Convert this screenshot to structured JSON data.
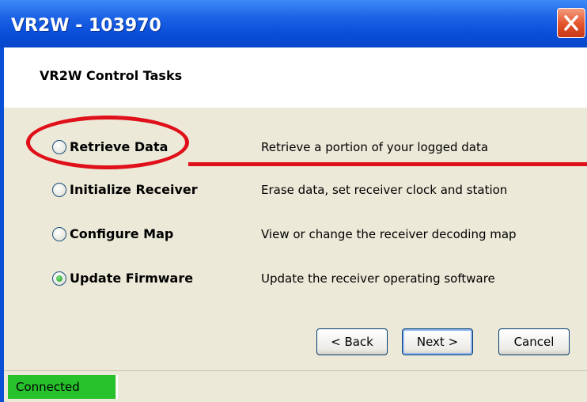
{
  "window": {
    "title": "VR2W - 103970"
  },
  "header": {
    "heading": "VR2W Control Tasks"
  },
  "tasks": [
    {
      "label": "Retrieve Data",
      "description": "Retrieve a portion of your logged data",
      "selected": false
    },
    {
      "label": "Initialize Receiver",
      "description": "Erase data, set receiver clock and station",
      "selected": false
    },
    {
      "label": "Configure Map",
      "description": "View or change the receiver decoding map",
      "selected": false
    },
    {
      "label": "Update Firmware",
      "description": "Update the receiver operating software",
      "selected": true
    }
  ],
  "buttons": {
    "back": "< Back",
    "next": "Next >",
    "cancel": "Cancel"
  },
  "status": {
    "connection": "Connected"
  },
  "colors": {
    "titlebar": "#0a4fd8",
    "annotation": "#e0101a",
    "connected": "#27c12b",
    "panel": "#ece9d8"
  },
  "icons": {
    "close": "close-icon",
    "radio": "radio-button"
  }
}
